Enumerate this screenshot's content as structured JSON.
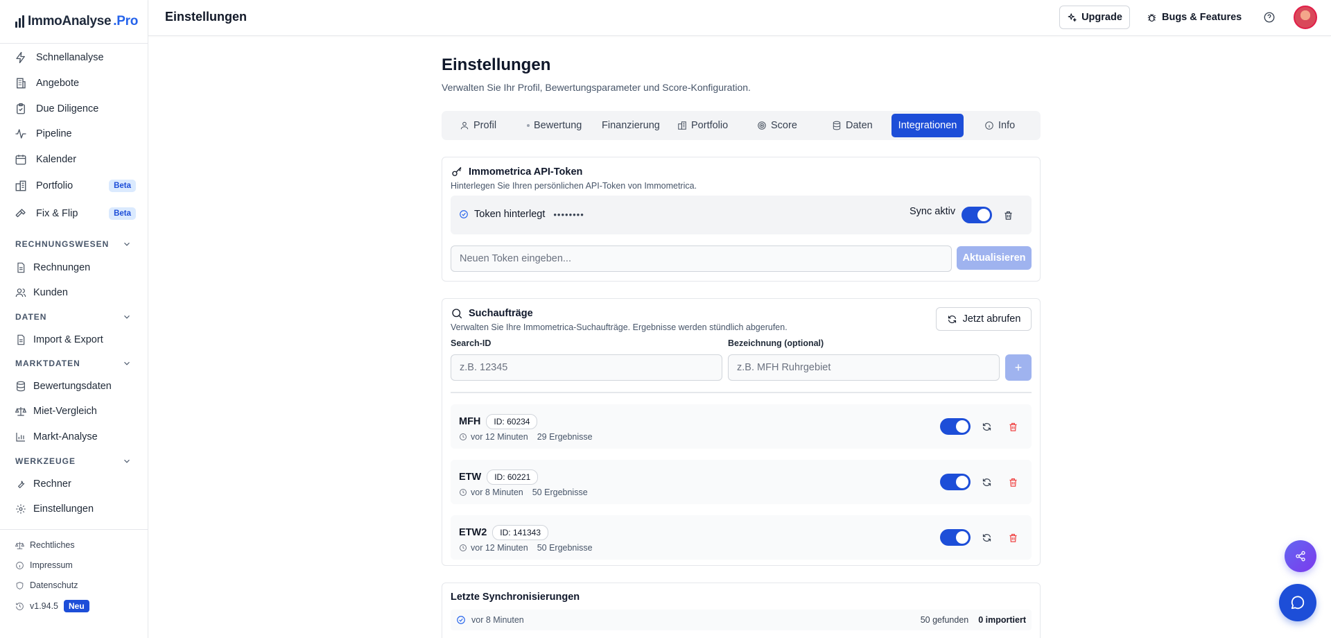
{
  "brand": {
    "name_main": "ImmoAnalyse",
    "name_suffix": ".Pro",
    "accent": "#2563eb"
  },
  "topbar": {
    "title": "Einstellungen",
    "upgrade_label": "Upgrade",
    "bugs_label": "Bugs & Features"
  },
  "sidebar": {
    "main_items": [
      {
        "label": "Schnellanalyse",
        "icon": "lightning-icon"
      },
      {
        "label": "Angebote",
        "icon": "building-icon"
      },
      {
        "label": "Due Diligence",
        "icon": "clipboard-icon"
      },
      {
        "label": "Pipeline",
        "icon": "activity-icon"
      },
      {
        "label": "Kalender",
        "icon": "calendar-icon"
      },
      {
        "label": "Portfolio",
        "icon": "buildings-icon",
        "badge": "Beta"
      },
      {
        "label": "Fix & Flip",
        "icon": "hammer-icon",
        "badge": "Beta"
      }
    ],
    "sections": [
      {
        "title": "Rechnungswesen",
        "items": [
          "Rechnungen",
          "Kunden"
        ]
      },
      {
        "title": "Daten",
        "items": [
          "Import & Export"
        ]
      },
      {
        "title": "Marktdaten",
        "items": [
          "Bewertungsdaten",
          "Miet-Vergleich",
          "Markt-Analyse"
        ]
      },
      {
        "title": "Werkzeuge",
        "items": [
          "Rechner",
          "Einstellungen"
        ]
      }
    ],
    "footer": {
      "legal": "Rechtliches",
      "imprint": "Impressum",
      "privacy": "Datenschutz",
      "version": "v1.94.5",
      "new_badge": "Neu"
    }
  },
  "page": {
    "title": "Einstellungen",
    "subtitle": "Verwalten Sie Ihr Profil, Bewertungsparameter und Score-Konfiguration."
  },
  "tabs": [
    {
      "label": "Profil"
    },
    {
      "label": "Bewertung"
    },
    {
      "label": "Finanzierung"
    },
    {
      "label": "Portfolio"
    },
    {
      "label": "Score"
    },
    {
      "label": "Daten"
    },
    {
      "label": "Integrationen",
      "active": true
    },
    {
      "label": "Info"
    }
  ],
  "api_token": {
    "title": "Immometrica API-Token",
    "description": "Hinterlegen Sie Ihren persönlichen API-Token von Immometrica.",
    "status": "Token hinterlegt",
    "masked": "••••••••",
    "sync_label": "Sync aktiv",
    "input_placeholder": "Neuen Token eingeben...",
    "update_label": "Aktualisieren"
  },
  "search_orders": {
    "title": "Suchaufträge",
    "description": "Verwalten Sie Ihre Immometrica-Suchaufträge. Ergebnisse werden stündlich abgerufen.",
    "fetch_label": "Jetzt abrufen",
    "search_id_label": "Search-ID",
    "search_id_placeholder": "z.B. 12345",
    "name_label": "Bezeichnung (optional)",
    "name_placeholder": "z.B. MFH Ruhrgebiet",
    "add_label": "+",
    "rows": [
      {
        "name": "MFH",
        "id": "ID: 60234",
        "time": "vor 12 Minuten",
        "results": "29 Ergebnisse"
      },
      {
        "name": "ETW",
        "id": "ID: 60221",
        "time": "vor 8 Minuten",
        "results": "50 Ergebnisse"
      },
      {
        "name": "ETW2",
        "id": "ID: 141343",
        "time": "vor 12 Minuten",
        "results": "50 Ergebnisse"
      }
    ]
  },
  "syncs": {
    "title": "Letzte Synchronisierungen",
    "rows": [
      {
        "time": "vor 8 Minuten",
        "found": "50 gefunden",
        "imported": "0 importiert"
      }
    ]
  }
}
